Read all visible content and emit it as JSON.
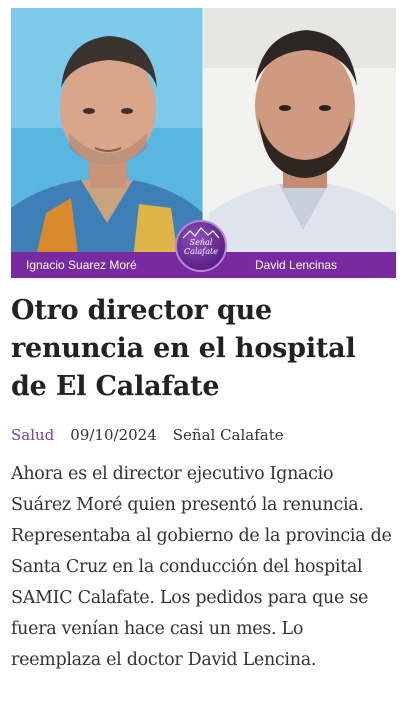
{
  "hero": {
    "left_caption": "Ignacio Suarez Moré",
    "right_caption": "David Lencinas",
    "logo_line1": "Señal",
    "logo_line2": "Calafate",
    "colors": {
      "caption_bar": "#7a2aa0",
      "left_background": "#58b6e0",
      "right_background": "#f2f2f0"
    }
  },
  "article": {
    "title": "Otro director que renuncia en el hospital de El Calafate",
    "category": "Salud",
    "date": "09/10/2024",
    "author": "Señal Calafate",
    "summary": "Ahora es el director ejecutivo Ignacio Suárez Moré quien presentó la renuncia. Representaba al gobierno de la provincia de Santa Cruz en la conducción del hospital SAMIC Calafate. Los pedidos para que se fuera venían hace casi un mes. Lo reemplaza el doctor David Lencina.",
    "category_color": "#7a3ea8"
  }
}
